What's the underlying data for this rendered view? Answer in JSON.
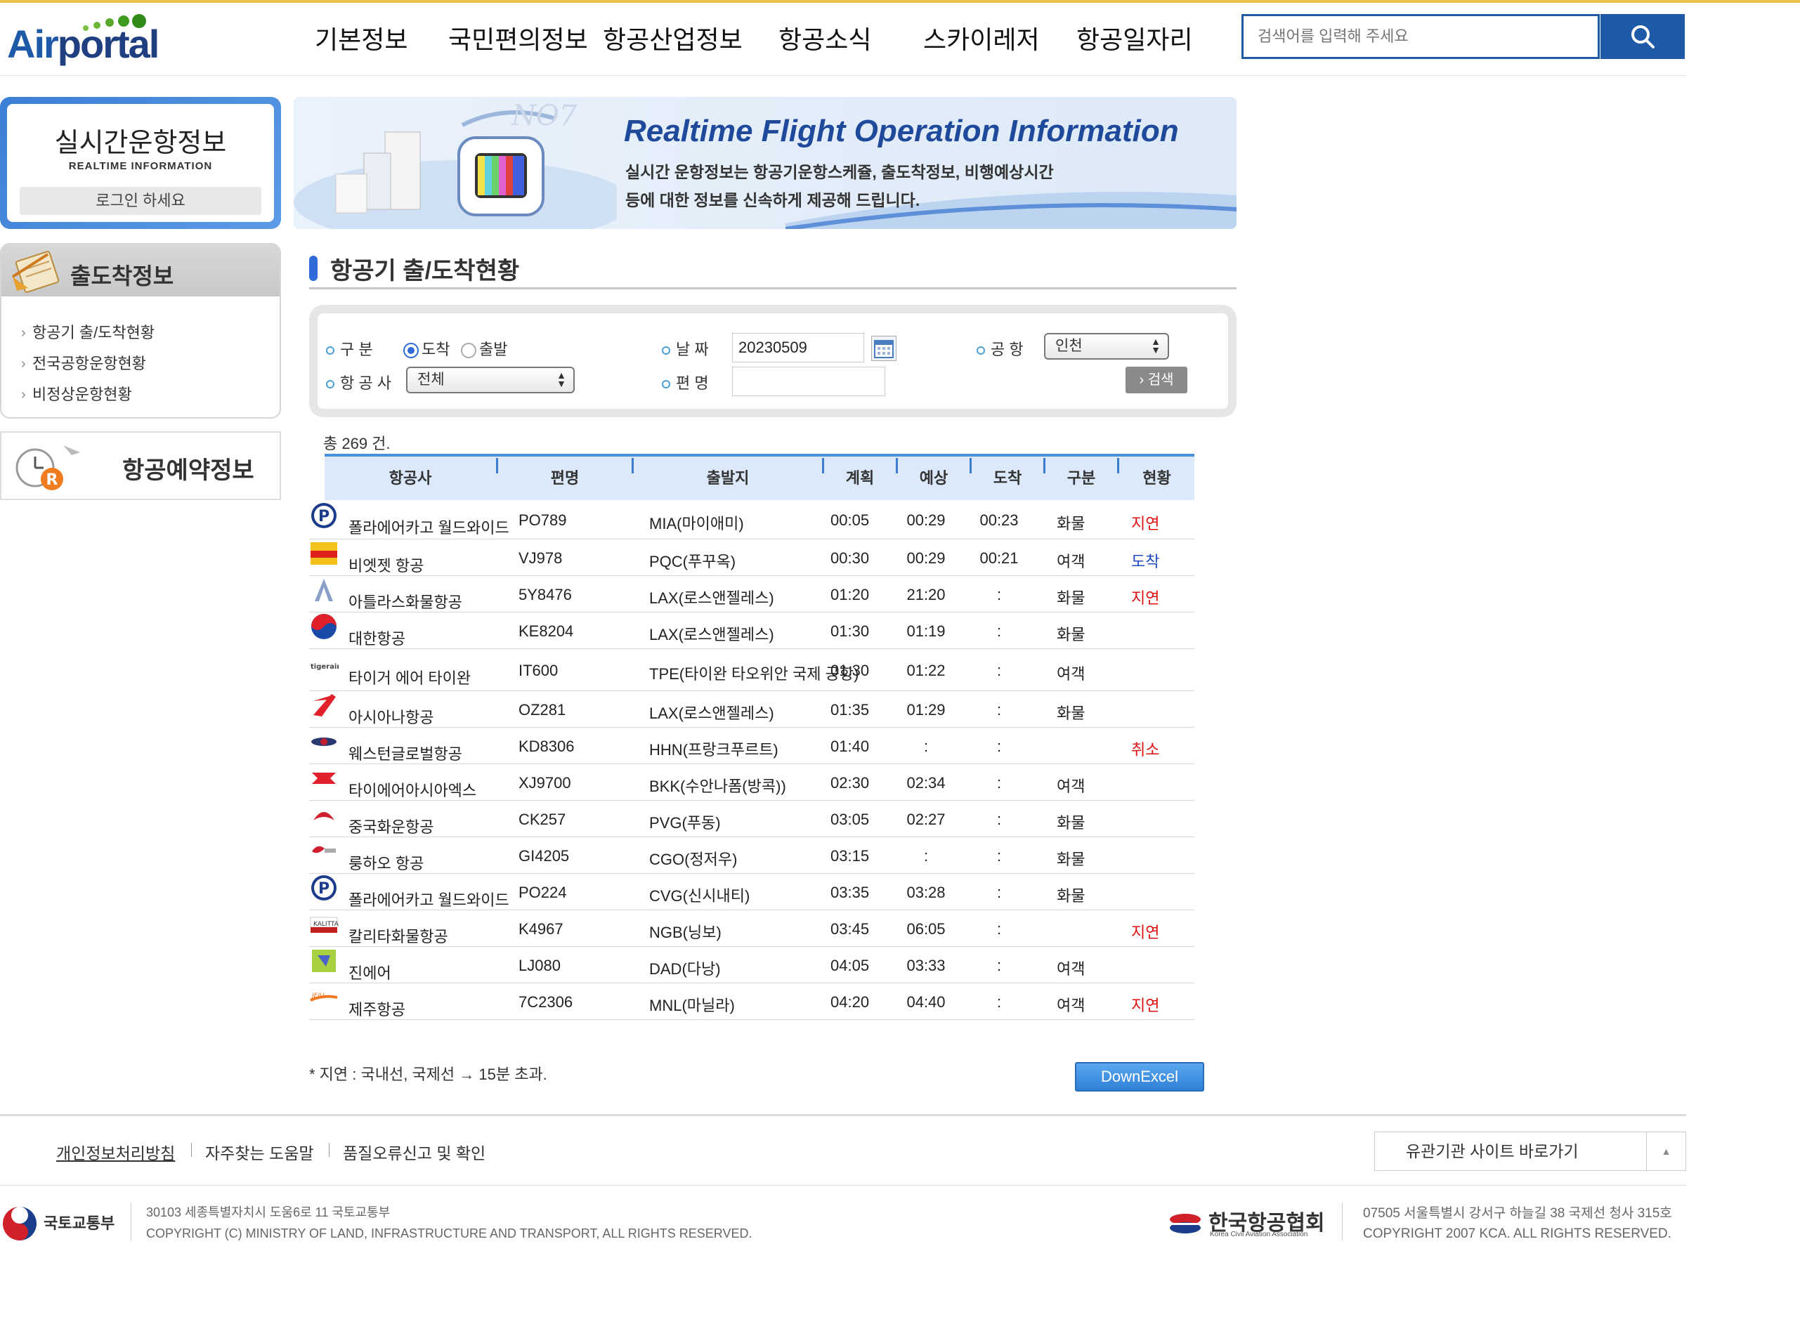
{
  "header": {
    "logo": {
      "air": "Air",
      "portal": "portal"
    },
    "nav": [
      "기본정보",
      "국민편의정보",
      "항공산업정보",
      "항공소식",
      "스카이레저",
      "항공일자리"
    ],
    "search_placeholder": "검색어를 입력해 주세요"
  },
  "sidebar": {
    "realtime_title": "실시간운항정보",
    "realtime_sub": "REALTIME INFORMATION",
    "login": "로그인 하세요",
    "menu_title": "출도착정보",
    "menu_items": [
      "항공기 출/도착현황",
      "전국공항운항현황",
      "비정상운항현황"
    ],
    "reserve_title": "항공예약정보"
  },
  "banner": {
    "title": "Realtime Flight Operation Information",
    "desc1": "실시간 운항정보는 항공기운항스케쥴, 출도착정보, 비행예상시간",
    "desc2": "등에 대한 정보를 신속하게 제공해 드립니다."
  },
  "page_title": "항공기 출/도착현황",
  "form": {
    "type_label": "구      분",
    "arrival": "도착",
    "departure": "출발",
    "airline_label": "항 공 사",
    "airline_value": "전체",
    "date_label": "날   짜",
    "date_value": "20230509",
    "flight_label": "편   명",
    "airport_label": "공  항",
    "airport_value": "인천",
    "search_btn": "› 검색"
  },
  "total": "총 269 건.",
  "table": {
    "headers": [
      "항공사",
      "편명",
      "출발지",
      "계획",
      "예상",
      "도착",
      "구분",
      "현황"
    ],
    "rows": [
      {
        "airline": "폴라에어카고 월드와이드",
        "flight": "PO789",
        "origin": "MIA(마이애미)",
        "plan": "00:05",
        "expect": "00:29",
        "arrive": "00:23",
        "kind": "화물",
        "status": "지연",
        "st": "delay",
        "icon": "polar"
      },
      {
        "airline": "비엣젯 항공",
        "flight": "VJ978",
        "origin": "PQC(푸꾸옥)",
        "plan": "00:30",
        "expect": "00:29",
        "arrive": "00:21",
        "kind": "여객",
        "status": "도착",
        "st": "arr",
        "icon": "vietjet"
      },
      {
        "airline": "아틀라스화물항공",
        "flight": "5Y8476",
        "origin": "LAX(로스앤젤레스)",
        "plan": "01:20",
        "expect": "21:20",
        "arrive": ":",
        "kind": "화물",
        "status": "지연",
        "st": "delay",
        "icon": "atlas"
      },
      {
        "airline": "대한항공",
        "flight": "KE8204",
        "origin": "LAX(로스앤젤레스)",
        "plan": "01:30",
        "expect": "01:19",
        "arrive": ":",
        "kind": "화물",
        "status": "",
        "st": "",
        "icon": "korean"
      },
      {
        "airline": "타이거 에어 타이완",
        "flight": "IT600",
        "origin": "TPE(타이완 타오위안 국제 공항)",
        "plan": "01:30",
        "expect": "01:22",
        "arrive": ":",
        "kind": "여객",
        "status": "",
        "st": "",
        "icon": "tiger"
      },
      {
        "airline": "아시아나항공",
        "flight": "OZ281",
        "origin": "LAX(로스앤젤레스)",
        "plan": "01:35",
        "expect": "01:29",
        "arrive": ":",
        "kind": "화물",
        "status": "",
        "st": "",
        "icon": "asiana"
      },
      {
        "airline": "웨스턴글로벌항공",
        "flight": "KD8306",
        "origin": "HHN(프랑크푸르트)",
        "plan": "01:40",
        "expect": ":",
        "arrive": ":",
        "kind": "",
        "status": "취소",
        "st": "cancel",
        "icon": "western"
      },
      {
        "airline": "타이에어아시아엑스",
        "flight": "XJ9700",
        "origin": "BKK(수안나폼(방콕))",
        "plan": "02:30",
        "expect": "02:34",
        "arrive": ":",
        "kind": "여객",
        "status": "",
        "st": "",
        "icon": "airasia"
      },
      {
        "airline": "중국화운항공",
        "flight": "CK257",
        "origin": "PVG(푸동)",
        "plan": "03:05",
        "expect": "02:27",
        "arrive": ":",
        "kind": "화물",
        "status": "",
        "st": "",
        "icon": "chinacargo"
      },
      {
        "airline": "룽하오 항공",
        "flight": "GI4205",
        "origin": "CGO(정저우)",
        "plan": "03:15",
        "expect": ":",
        "arrive": ":",
        "kind": "화물",
        "status": "",
        "st": "",
        "icon": "longhao"
      },
      {
        "airline": "폴라에어카고 월드와이드",
        "flight": "PO224",
        "origin": "CVG(신시내티)",
        "plan": "03:35",
        "expect": "03:28",
        "arrive": ":",
        "kind": "화물",
        "status": "",
        "st": "",
        "icon": "polar"
      },
      {
        "airline": "칼리타화물항공",
        "flight": "K4967",
        "origin": "NGB(닝보)",
        "plan": "03:45",
        "expect": "06:05",
        "arrive": ":",
        "kind": "",
        "status": "지연",
        "st": "delay",
        "icon": "kalitta"
      },
      {
        "airline": "진에어",
        "flight": "LJ080",
        "origin": "DAD(다낭)",
        "plan": "04:05",
        "expect": "03:33",
        "arrive": ":",
        "kind": "여객",
        "status": "",
        "st": "",
        "icon": "jinair"
      },
      {
        "airline": "제주항공",
        "flight": "7C2306",
        "origin": "MNL(마닐라)",
        "plan": "04:20",
        "expect": "04:40",
        "arrive": ":",
        "kind": "여객",
        "status": "지연",
        "st": "delay",
        "icon": "jeju"
      }
    ]
  },
  "note": "* 지연 : 국내선, 국제선 → 15분 초과.",
  "excel_btn": "DownExcel",
  "footer": {
    "links": [
      "개인정보처리방침",
      "자주찾는 도움말",
      "품질오류신고 및 확인"
    ],
    "related": "유관기관 사이트 바로가기",
    "molit_name": "국토교통부",
    "molit_addr": "30103 세종특별자치시 도움6로 11 국토교통부",
    "molit_copy": "COPYRIGHT (C) MINISTRY OF LAND, INFRASTRUCTURE AND TRANSPORT, ALL RIGHTS RESERVED.",
    "kca_name": "한국항공협회",
    "kca_sub": "Korea Civil Aviation Association",
    "kca_addr": "07505 서울특별시 강서구 하늘길 38 국제선 청사 315호",
    "kca_copy": "COPYRIGHT 2007 KCA. ALL RIGHTS RESERVED."
  }
}
